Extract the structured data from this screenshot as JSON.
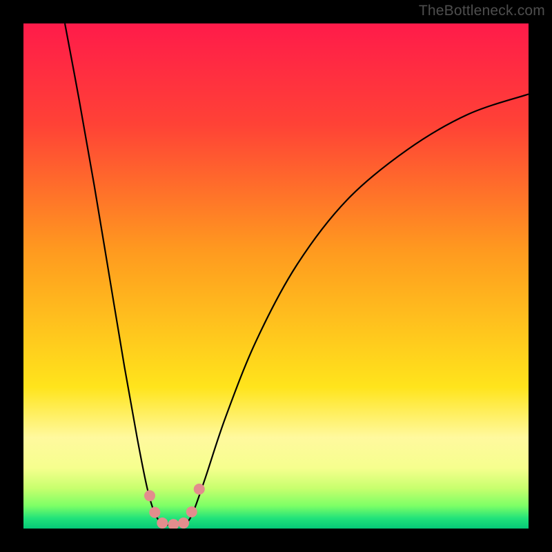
{
  "watermark": "TheBottleneck.com",
  "colors": {
    "black": "#000000",
    "gradient_stops": [
      {
        "pos": 0.0,
        "c": "#ff1b4a"
      },
      {
        "pos": 0.2,
        "c": "#ff4236"
      },
      {
        "pos": 0.45,
        "c": "#ff9a1f"
      },
      {
        "pos": 0.72,
        "c": "#ffe41c"
      },
      {
        "pos": 0.82,
        "c": "#fff99e"
      },
      {
        "pos": 0.88,
        "c": "#f6ff8e"
      },
      {
        "pos": 0.92,
        "c": "#c8ff6e"
      },
      {
        "pos": 0.955,
        "c": "#7dff66"
      },
      {
        "pos": 0.98,
        "c": "#21e27a"
      },
      {
        "pos": 1.0,
        "c": "#05c877"
      }
    ],
    "curve": "#000000",
    "marker": "#e38d8d"
  },
  "chart_data": {
    "type": "line",
    "title": "",
    "xlabel": "",
    "ylabel": "",
    "xlim": [
      0,
      100
    ],
    "ylim": [
      0,
      100
    ],
    "left_curve": [
      {
        "x": 8.2,
        "y": 100
      },
      {
        "x": 11,
        "y": 85
      },
      {
        "x": 14,
        "y": 68
      },
      {
        "x": 17,
        "y": 50
      },
      {
        "x": 20,
        "y": 32
      },
      {
        "x": 22.5,
        "y": 18
      },
      {
        "x": 24.5,
        "y": 8
      },
      {
        "x": 26,
        "y": 3
      },
      {
        "x": 27.5,
        "y": 0.7
      }
    ],
    "right_curve": [
      {
        "x": 32,
        "y": 0.7
      },
      {
        "x": 33.5,
        "y": 3
      },
      {
        "x": 36,
        "y": 10
      },
      {
        "x": 40,
        "y": 22
      },
      {
        "x": 46,
        "y": 37
      },
      {
        "x": 54,
        "y": 52
      },
      {
        "x": 64,
        "y": 65
      },
      {
        "x": 76,
        "y": 75
      },
      {
        "x": 88,
        "y": 82
      },
      {
        "x": 100,
        "y": 86
      }
    ],
    "bottom_flat": [
      {
        "x": 27.5,
        "y": 0.7
      },
      {
        "x": 32,
        "y": 0.7
      }
    ],
    "markers": [
      {
        "x": 25.0,
        "y": 6.5
      },
      {
        "x": 26.0,
        "y": 3.2
      },
      {
        "x": 27.5,
        "y": 1.1
      },
      {
        "x": 29.7,
        "y": 0.8
      },
      {
        "x": 31.7,
        "y": 1.1
      },
      {
        "x": 33.3,
        "y": 3.3
      },
      {
        "x": 34.8,
        "y": 7.8
      }
    ],
    "marker_radius_px": 8
  }
}
